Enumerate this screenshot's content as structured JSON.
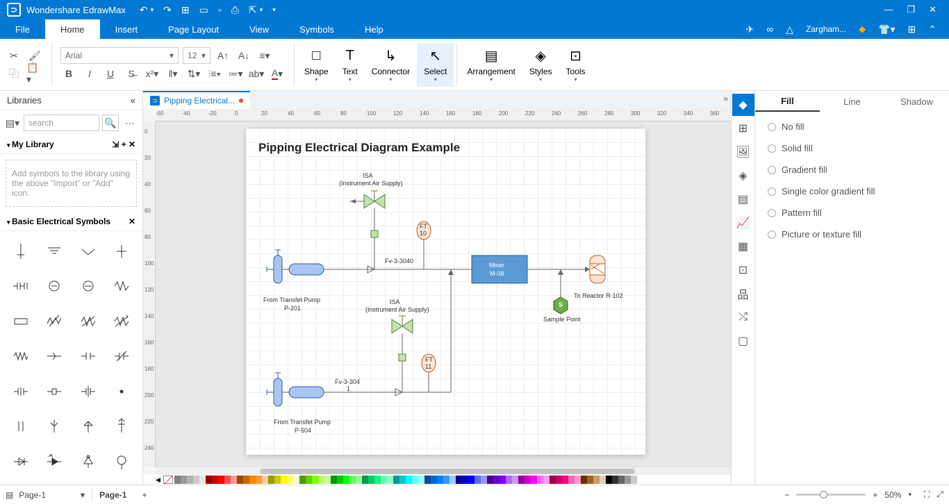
{
  "app": {
    "name": "Wondershare EdrawMax",
    "user": "Zargham..."
  },
  "menu": {
    "tabs": [
      "File",
      "Home",
      "Insert",
      "Page Layout",
      "View",
      "Symbols",
      "Help"
    ],
    "active": "Home"
  },
  "ribbon": {
    "font": "Arial",
    "size": "12",
    "tools": [
      {
        "icon": "□",
        "label": "Shape",
        "dd": true
      },
      {
        "icon": "T",
        "label": "Text",
        "dd": true
      },
      {
        "icon": "↘",
        "label": "Connector",
        "dd": true
      },
      {
        "icon": "↖",
        "label": "Select",
        "dd": true,
        "active": true
      },
      {
        "icon": "⊞",
        "label": "Arrangement",
        "dd": true
      },
      {
        "icon": "◈",
        "label": "Styles",
        "dd": true
      },
      {
        "icon": "⊡",
        "label": "Tools",
        "dd": true
      }
    ]
  },
  "left": {
    "title": "Libraries",
    "search_placeholder": "search",
    "section1": "My Library",
    "hint": "Add symbols to the library using the above \"Import\" or \"Add\" icon.",
    "section2": "Basic Electrical Symbols"
  },
  "doc": {
    "tab": "Pipping Electrical..."
  },
  "diagram": {
    "title": "Pipping Electrical Diagram Example",
    "isa1": "ISA",
    "isa1sub": "(Instrument Air Supply)",
    "ft10a": "FT",
    "ft10b": "10",
    "fv1": "Fv-3-3040",
    "mixer1": "Mixer",
    "mixer2": "M-08",
    "pump1a": "From Transfet Pump",
    "pump1b": "P-201",
    "reactor": "To Reactor R-102",
    "sample": "Sample Point",
    "s": "S",
    "isa2": "ISA",
    "isa2sub": "(Instrument Air Supply)",
    "ft11a": "FT",
    "ft11b": "11",
    "fv2a": "Fv-3-304",
    "fv2b": "1",
    "pump2a": "From Transfet Pump",
    "pump2b": "P-504"
  },
  "right": {
    "tabs": [
      "Fill",
      "Line",
      "Shadow"
    ],
    "active": "Fill",
    "options": [
      "No fill",
      "Solid fill",
      "Gradient fill",
      "Single color gradient fill",
      "Pattern fill",
      "Picture or texture fill"
    ]
  },
  "status": {
    "page_sel": "Page-1",
    "page_tab": "Page-1",
    "zoom": "50%"
  },
  "ruler_h": [
    -60,
    -40,
    -20,
    0,
    20,
    40,
    60,
    80,
    100,
    120,
    140,
    160,
    180,
    200,
    220,
    240,
    260,
    280,
    300,
    320,
    340,
    360
  ],
  "ruler_v": [
    0,
    20,
    40,
    60,
    80,
    100,
    120,
    140,
    160,
    180,
    200,
    220,
    240
  ],
  "colors": [
    "#808080",
    "#999999",
    "#b3b3b3",
    "#cccccc",
    "#e6e6e6",
    "#990000",
    "#cc0000",
    "#ff0000",
    "#ff4d4d",
    "#ff9999",
    "#994c00",
    "#cc6600",
    "#ff8000",
    "#ff9933",
    "#ffcc99",
    "#999900",
    "#cccc00",
    "#ffff00",
    "#ffff66",
    "#ffffcc",
    "#4c9900",
    "#66cc00",
    "#80ff00",
    "#b3ff66",
    "#ccff99",
    "#009900",
    "#00cc00",
    "#00ff00",
    "#66ff66",
    "#99ff99",
    "#00994c",
    "#00cc66",
    "#00ff80",
    "#66ffb3",
    "#99ffcc",
    "#009999",
    "#00cccc",
    "#00ffff",
    "#66ffff",
    "#99ffff",
    "#004c99",
    "#0066cc",
    "#0080ff",
    "#3399ff",
    "#99ccff",
    "#000099",
    "#0000cc",
    "#0000ff",
    "#6666ff",
    "#9999ff",
    "#4c0099",
    "#6600cc",
    "#8000ff",
    "#b366ff",
    "#cc99ff",
    "#990099",
    "#cc00cc",
    "#ff00ff",
    "#ff66ff",
    "#ff99ff",
    "#99004c",
    "#cc0066",
    "#ff0080",
    "#ff66b3",
    "#ff99cc",
    "#663300",
    "#996633",
    "#cc9966",
    "#e6ccb3",
    "#000000",
    "#333333",
    "#666666",
    "#999999",
    "#cccccc",
    "#ffffff"
  ]
}
